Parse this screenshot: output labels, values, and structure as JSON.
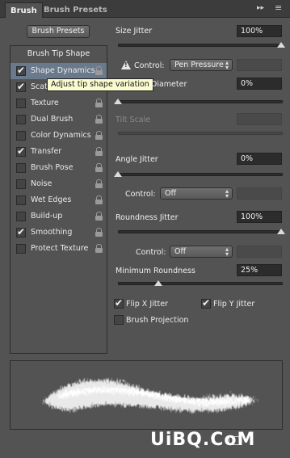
{
  "tabs": [
    {
      "label": "Brush",
      "active": true
    },
    {
      "label": "Brush Presets",
      "active": false
    }
  ],
  "tab_controls": {
    "collapse": "▸▸",
    "menu": "≡"
  },
  "brush_presets_button": "Brush Presets",
  "tip_shape_label": "Brush Tip Shape",
  "settings": [
    {
      "label": "Shape Dynamics",
      "checked": true,
      "selected": true
    },
    {
      "label": "Scattering",
      "checked": true,
      "selected": false
    },
    {
      "label": "Texture",
      "checked": false,
      "selected": false
    },
    {
      "label": "Dual Brush",
      "checked": false,
      "selected": false
    },
    {
      "label": "Color Dynamics",
      "checked": false,
      "selected": false
    },
    {
      "label": "Transfer",
      "checked": true,
      "selected": false
    },
    {
      "label": "Brush Pose",
      "checked": false,
      "selected": false
    },
    {
      "label": "Noise",
      "checked": false,
      "selected": false
    },
    {
      "label": "Wet Edges",
      "checked": false,
      "selected": false
    },
    {
      "label": "Build-up",
      "checked": false,
      "selected": false
    },
    {
      "label": "Smoothing",
      "checked": true,
      "selected": false
    },
    {
      "label": "Protect Texture",
      "checked": false,
      "selected": false
    }
  ],
  "tooltip": "Adjust tip shape variation",
  "size_jitter": {
    "label": "Size Jitter",
    "value": "100%",
    "slider": 1.0
  },
  "size_control": {
    "label": "Control:",
    "value": "Pen Pressure",
    "icon": "warning-icon"
  },
  "min_diameter": {
    "label": "Diameter",
    "value": "0%",
    "slider": 0.0
  },
  "tilt_scale": {
    "label": "Tilt Scale"
  },
  "angle_jitter": {
    "label": "Angle Jitter",
    "value": "0%",
    "slider": 0.0
  },
  "angle_control": {
    "label": "Control:",
    "value": "Off"
  },
  "roundness_jitter": {
    "label": "Roundness Jitter",
    "value": "100%",
    "slider": 1.0
  },
  "roundness_control": {
    "label": "Control:",
    "value": "Off"
  },
  "minimum_roundness": {
    "label": "Minimum Roundness",
    "value": "25%",
    "slider": 0.25
  },
  "flip_x": {
    "label": "Flip X Jitter",
    "checked": true
  },
  "flip_y": {
    "label": "Flip Y Jitter",
    "checked": true
  },
  "brush_projection": {
    "label": "Brush Projection",
    "checked": false
  },
  "watermark": "UiBQ.CoM"
}
